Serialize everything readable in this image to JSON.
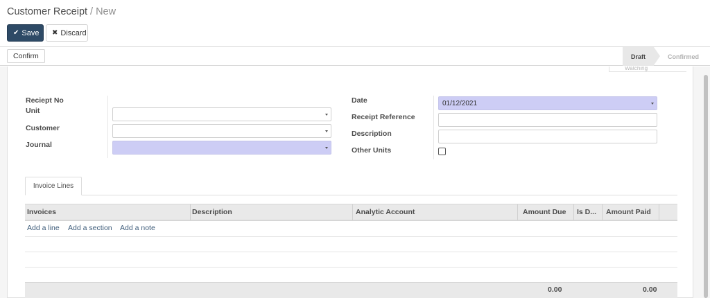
{
  "breadcrumb": {
    "parent": "Customer Receipt",
    "separator": "/",
    "current": "New"
  },
  "buttons": {
    "save": "Save",
    "discard": "Discard",
    "confirm": "Confirm"
  },
  "statusbar": {
    "stages": [
      "Draft",
      "Confirmed"
    ],
    "active_stage": "Draft"
  },
  "chatter": {
    "peek_text": "Watching"
  },
  "form": {
    "left": {
      "receipt_no_label": "Reciept No",
      "unit_label": "Unit",
      "unit_value": "",
      "customer_label": "Customer",
      "customer_value": "",
      "journal_label": "Journal",
      "journal_value": ""
    },
    "right": {
      "date_label": "Date",
      "date_value": "01/12/2021",
      "receipt_reference_label": "Receipt Reference",
      "receipt_reference_value": "",
      "description_label": "Description",
      "description_value": "",
      "other_units_label": "Other Units",
      "other_units_checked": false
    }
  },
  "tabs": [
    {
      "label": "Invoice Lines",
      "active": true
    }
  ],
  "invoice_table": {
    "columns": [
      "Invoices",
      "Description",
      "Analytic Account",
      "Amount Due",
      "Is D...",
      "Amount Paid"
    ],
    "actions": [
      "Add a line",
      "Add a section",
      "Add a note"
    ],
    "totals": {
      "amount_due": "0.00",
      "amount_paid": "0.00"
    }
  },
  "colors": {
    "primary": "#2e4a66",
    "required_field": "#cdcdf5",
    "link": "#3e5c7a"
  }
}
